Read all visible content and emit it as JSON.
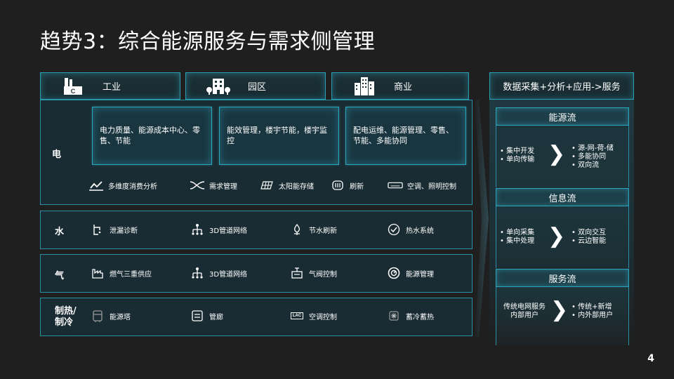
{
  "page": {
    "title": "趋势3：综合能源服务与需求侧管理",
    "number": "4"
  },
  "headers": [
    {
      "label": "工业",
      "icon": "factory-icon"
    },
    {
      "label": "园区",
      "icon": "building-icon"
    },
    {
      "label": "商业",
      "icon": "office-towers-icon"
    }
  ],
  "right_header": "数据采集+分析+应用->服务",
  "electric": {
    "label": "电",
    "boxes": [
      "电力质量、能源成本中心、零售、节能",
      "能效管理，楼宇节能，楼宇监控",
      "配电运维、能源管理、零售、节能、多能协同"
    ],
    "items": [
      {
        "label": "多维度消费分析",
        "icon": "trend-chart-icon"
      },
      {
        "label": "需求管理",
        "icon": "crossing-arrows-icon"
      },
      {
        "label": "太阳能存储",
        "icon": "solar-panel-icon"
      },
      {
        "label": "刷新",
        "icon": "radiator-icon"
      },
      {
        "label": "空调、照明控制",
        "icon": "air-conditioner-icon"
      }
    ]
  },
  "water": {
    "label": "水",
    "items": [
      {
        "label": "泄漏诊断",
        "icon": "leak-pipe-icon"
      },
      {
        "label": "3D管道网络",
        "icon": "network-icon"
      },
      {
        "label": "节水刷新",
        "icon": "water-drop-plant-icon"
      },
      {
        "label": "热水系统",
        "icon": "gauge-check-icon"
      }
    ]
  },
  "gas": {
    "label": "气",
    "items": [
      {
        "label": "燃气三重供应",
        "icon": "factory-outline-icon"
      },
      {
        "label": "3D管道网络",
        "icon": "network-icon"
      },
      {
        "label": "气阀控制",
        "icon": "valve-icon"
      },
      {
        "label": "能源管理",
        "icon": "dial-icon"
      }
    ]
  },
  "heating": {
    "label_line1": "制热/",
    "label_line2": "制冷",
    "items": [
      {
        "label": "能源塔",
        "icon": "tank-icon"
      },
      {
        "label": "管廊",
        "icon": "pipe-gallery-icon"
      },
      {
        "label": "空调控制",
        "icon": "lac-icon",
        "icon_text": "LAC"
      },
      {
        "label": "蓄冷蓄热",
        "icon": "storage-icon"
      }
    ]
  },
  "flows": [
    {
      "title": "能源流",
      "left": [
        "集中开发",
        "单向传输"
      ],
      "right": [
        "源-网-荷-储",
        "多能协同",
        "双向流"
      ]
    },
    {
      "title": "信息流",
      "left": [
        "单向采集",
        "集中处理"
      ],
      "right": [
        "双向交互",
        "云边智能"
      ]
    },
    {
      "title": "服务流",
      "left_plain": [
        "传统电网服务",
        "内部用户"
      ],
      "right": [
        "传统+新增",
        "内外部用户"
      ]
    }
  ],
  "colors": {
    "accent": "#2aa6bd",
    "background": "#1f1f1f",
    "panel": "#1a2c33"
  }
}
